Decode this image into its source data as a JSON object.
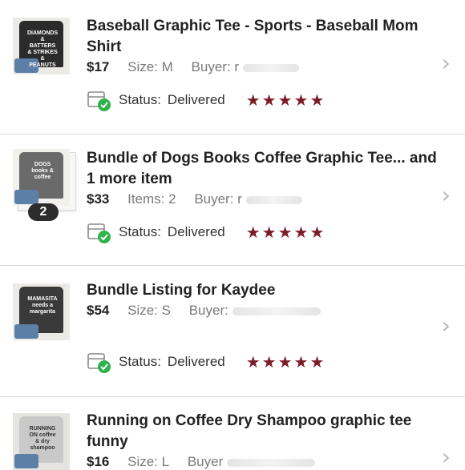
{
  "orders": [
    {
      "title": "Baseball Graphic Tee - Sports - Baseball Mom Shirt",
      "price": "$17",
      "detail": "Size: M",
      "buyer_label": "Buyer:",
      "buyer_partial": "r",
      "status_label": "Status:",
      "status_value": "Delivered",
      "stars": "★★★★★",
      "thumb_text": "DIAMONDS & BATTERS & STRIKES & PEANUTS",
      "shirt_color": "#2b2b2b"
    },
    {
      "title": "Bundle of Dogs Books Coffee Graphic Tee... and 1 more item",
      "price": "$33",
      "detail": "Items: 2",
      "buyer_label": "Buyer:",
      "buyer_partial": "r",
      "status_label": "Status:",
      "status_value": "Delivered",
      "stars": "★★★★★",
      "badge": "2",
      "thumb_text": "DOGS books & coffee",
      "shirt_color": "#6a6a6a"
    },
    {
      "title": "Bundle Listing for Kaydee",
      "price": "$54",
      "detail": "Size: S",
      "buyer_label": "Buyer:",
      "buyer_partial": "",
      "status_label": "Status:",
      "status_value": "Delivered",
      "stars": "★★★★★",
      "thumb_text": "MAMASITA needs a margarita",
      "shirt_color": "#3a3a3a"
    },
    {
      "title": "Running on Coffee Dry Shampoo graphic tee funny",
      "price": "$16",
      "detail": "Size: L",
      "buyer_label": "Buyer",
      "buyer_partial": "",
      "thumb_text": "RUNNING ON coffee & dry shampoo",
      "shirt_color": "#c9c9c9"
    }
  ],
  "colors": {
    "star": "#7a1d2a",
    "check_green": "#2eb24a",
    "chevron": "#b5b5b5",
    "divider": "#d8d8d8"
  },
  "icons": {
    "status": "box-with-check-icon",
    "chevron": "chevron-right-icon",
    "star": "star-icon"
  }
}
